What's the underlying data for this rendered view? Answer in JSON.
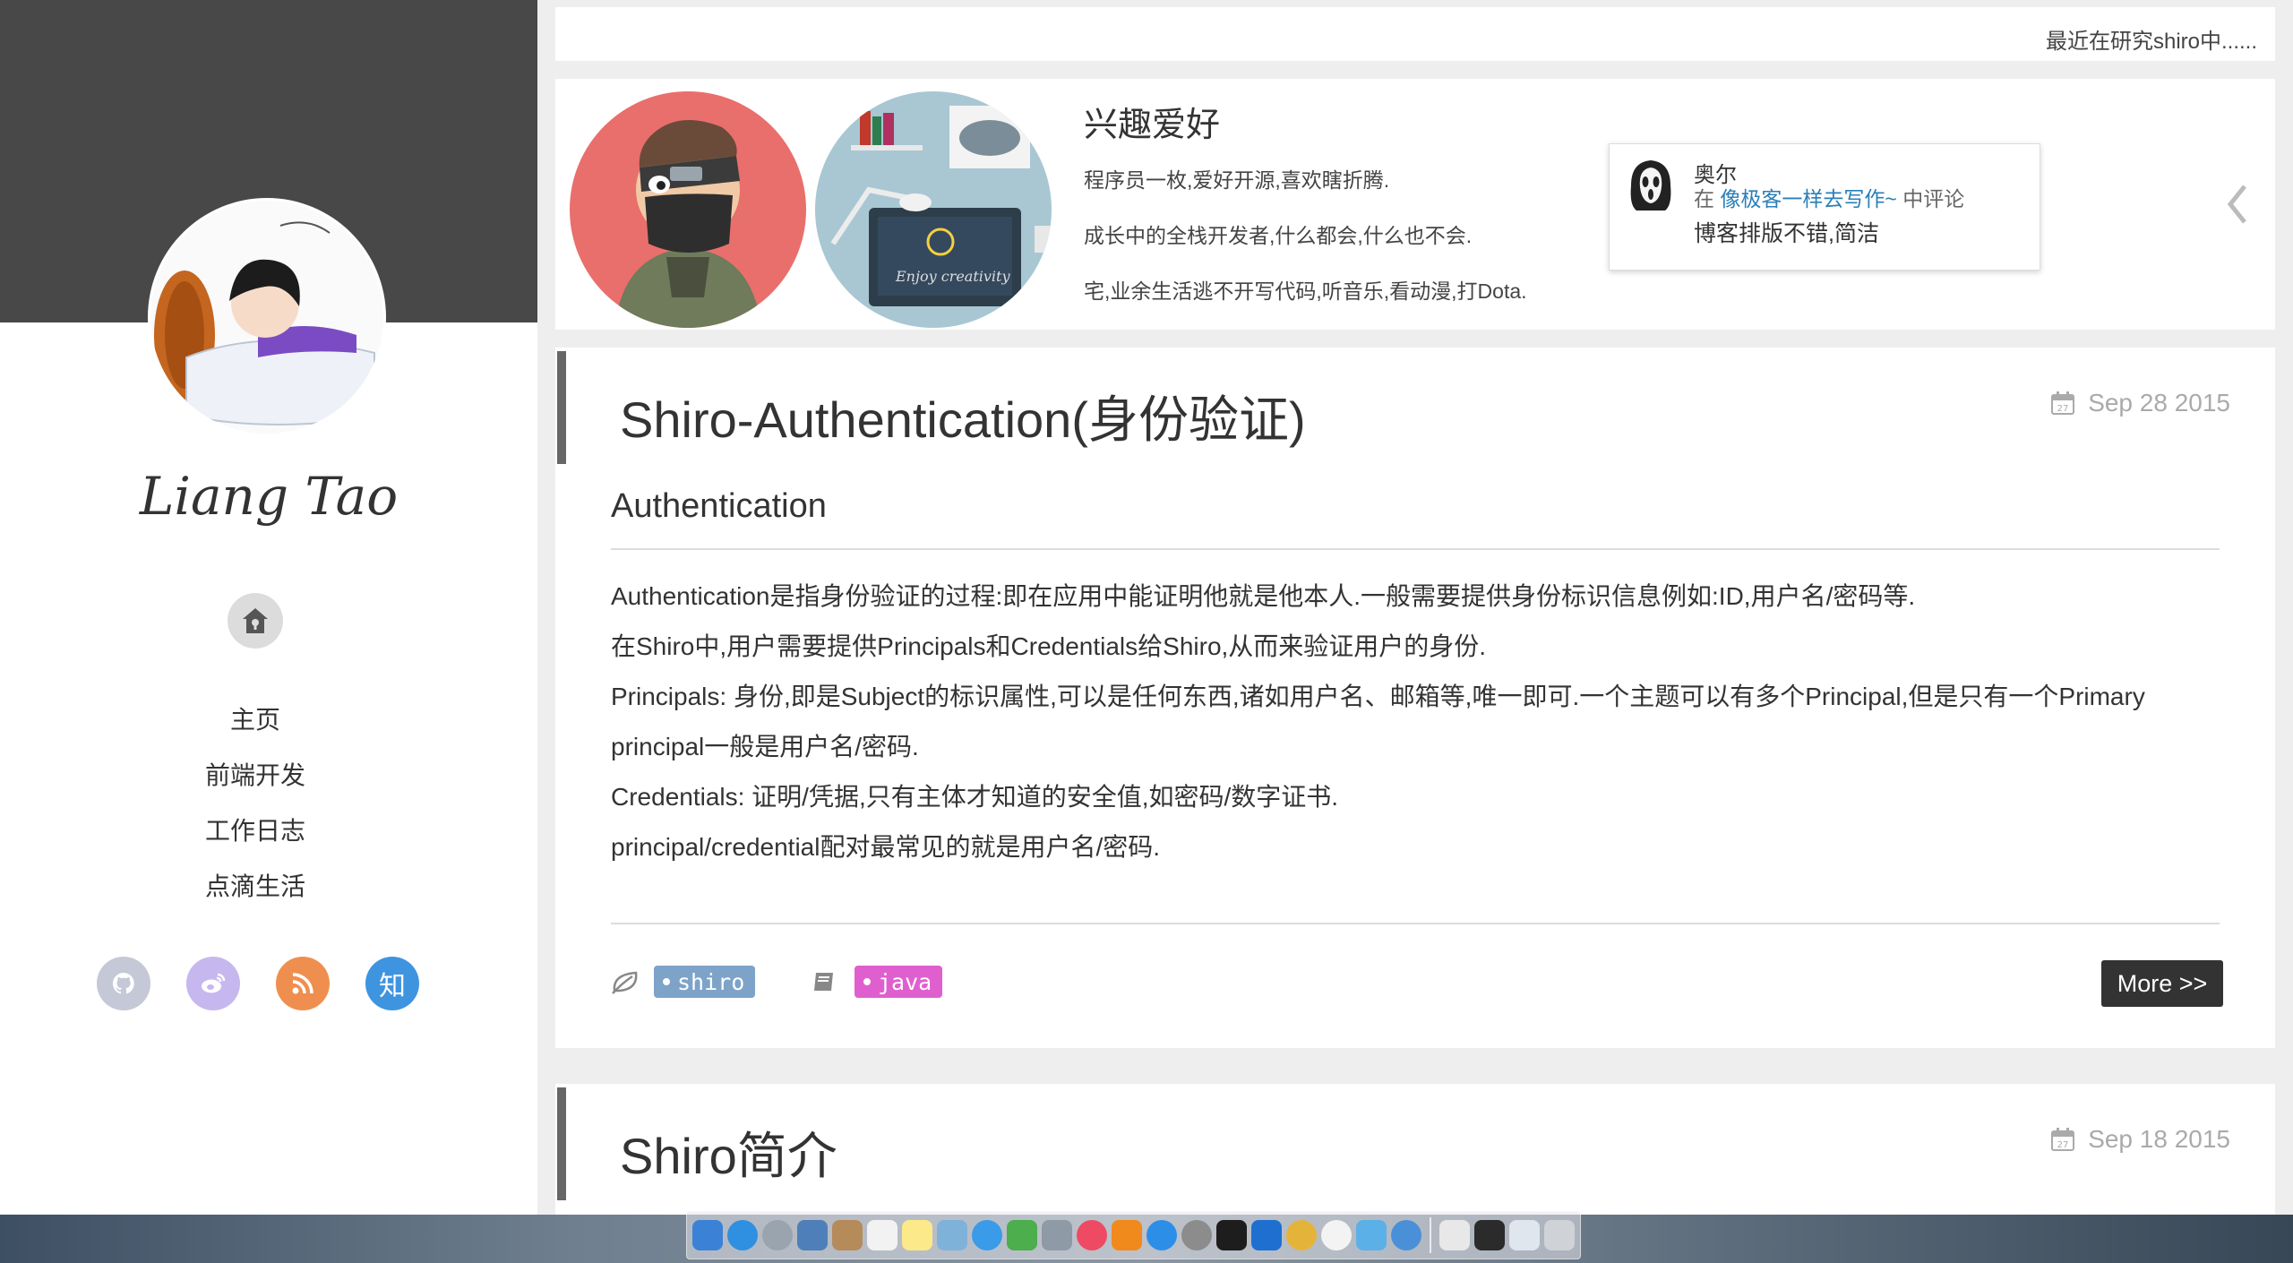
{
  "sidebar": {
    "author_name": "Liang Tao",
    "nav": [
      "主页",
      "前端开发",
      "工作日志",
      "点滴生活"
    ],
    "socials": [
      {
        "name": "github-icon",
        "glyph": "",
        "color": "#c5c8d6"
      },
      {
        "name": "weibo-icon",
        "glyph": "",
        "color": "#c7b7ef"
      },
      {
        "name": "rss-icon",
        "glyph": "",
        "color": "#ef8f4f"
      },
      {
        "name": "zhihu-icon",
        "glyph": "知",
        "color": "#3f94e0"
      }
    ]
  },
  "topbar": {
    "status_text": "最近在研究shiro中......"
  },
  "about": {
    "title": "兴趣爱好",
    "lines": [
      "程序员一枚,爱好开源,喜欢瞎折腾.",
      "成长中的全栈开发者,什么都会,什么也不会.",
      "宅,业余生活逃不开写代码,听音乐,看动漫,打Dota."
    ],
    "comment": {
      "user": "奥尔",
      "prefix": "在 ",
      "link": "像极客一样去写作~",
      "suffix": " 中评论",
      "body": "博客排版不错,简洁"
    }
  },
  "posts": [
    {
      "title": "Shiro-Authentication(身份验证)",
      "date": "Sep 28 2015",
      "heading": "Authentication",
      "paragraphs": [
        "Authentication是指身份验证的过程:即在应用中能证明他就是他本人.一般需要提供身份标识信息例如:ID,用户名/密码等.",
        "在Shiro中,用户需要提供Principals和Credentials给Shiro,从而来验证用户的身份.",
        "Principals: 身份,即是Subject的标识属性,可以是任何东西,诸如用户名、邮箱等,唯一即可.一个主题可以有多个Principal,但是只有一个Primary",
        "principal一般是用户名/密码.",
        "Credentials: 证明/凭据,只有主体才知道的安全值,如密码/数字证书.",
        "principal/credential配对最常见的就是用户名/密码."
      ],
      "tag": "shiro",
      "category": "java",
      "more_label": "More >>"
    },
    {
      "title": "Shiro简介",
      "date": "Sep 18 2015"
    }
  ],
  "colors": {
    "tag": "#7ea3c9",
    "category": "#e05fcf",
    "sidebar_header": "#484848",
    "link": "#2a7fb8"
  }
}
